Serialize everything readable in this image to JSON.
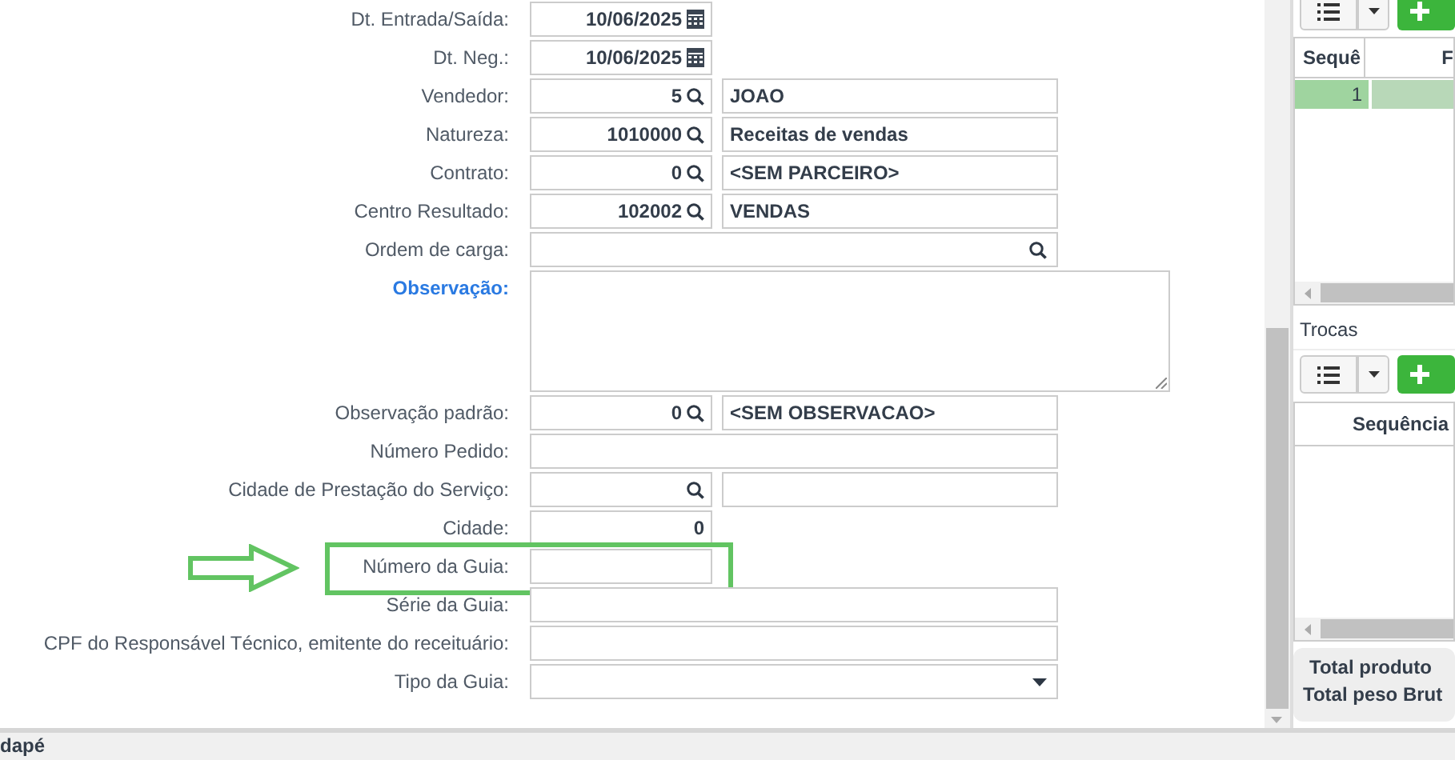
{
  "form": {
    "fields": [
      {
        "label": "Dt. Entrada/Saída:",
        "kind": "date",
        "value": "10/06/2025"
      },
      {
        "label": "Dt. Neg.:",
        "kind": "date",
        "value": "10/06/2025"
      },
      {
        "label": "Vendedor:",
        "kind": "lookup",
        "value": "5",
        "description": "JOAO"
      },
      {
        "label": "Natureza:",
        "kind": "lookup",
        "value": "1010000",
        "description": "Receitas de vendas"
      },
      {
        "label": "Contrato:",
        "kind": "lookup",
        "value": "0",
        "description": "<SEM PARCEIRO>"
      },
      {
        "label": "Centro Resultado:",
        "kind": "lookup",
        "value": "102002",
        "description": "VENDAS"
      },
      {
        "label": "Ordem de carga:",
        "kind": "lookup-wide"
      },
      {
        "label": "Observação:",
        "kind": "textarea",
        "emphasized": true
      },
      {
        "label": "Observação padrão:",
        "kind": "lookup",
        "value": "0",
        "description": "<SEM OBSERVACAO>"
      },
      {
        "label": "Número Pedido:",
        "kind": "text"
      },
      {
        "label": "Cidade de Prestação do Serviço:",
        "kind": "lookup",
        "description_field": true
      },
      {
        "label": "Cidade:",
        "kind": "number",
        "value": "0"
      },
      {
        "label": "Número da Guia:",
        "kind": "short",
        "highlighted": true
      },
      {
        "label": "Série da Guia:",
        "kind": "text"
      },
      {
        "label": "CPF do Responsável Técnico, emitente do receituário:",
        "kind": "text"
      },
      {
        "label": "Tipo da Guia:",
        "kind": "select"
      }
    ]
  },
  "side_panel": {
    "grid_1": {
      "columns": [
        "Sequê",
        "F"
      ],
      "rows": [
        {
          "cells": [
            "1"
          ],
          "selected": true
        }
      ]
    },
    "section_title": "Trocas",
    "grid_2": {
      "columns": [
        "Sequência"
      ]
    },
    "totals": [
      "Total produto",
      "Total peso Brut"
    ]
  },
  "footer": {
    "title": "dapé"
  }
}
